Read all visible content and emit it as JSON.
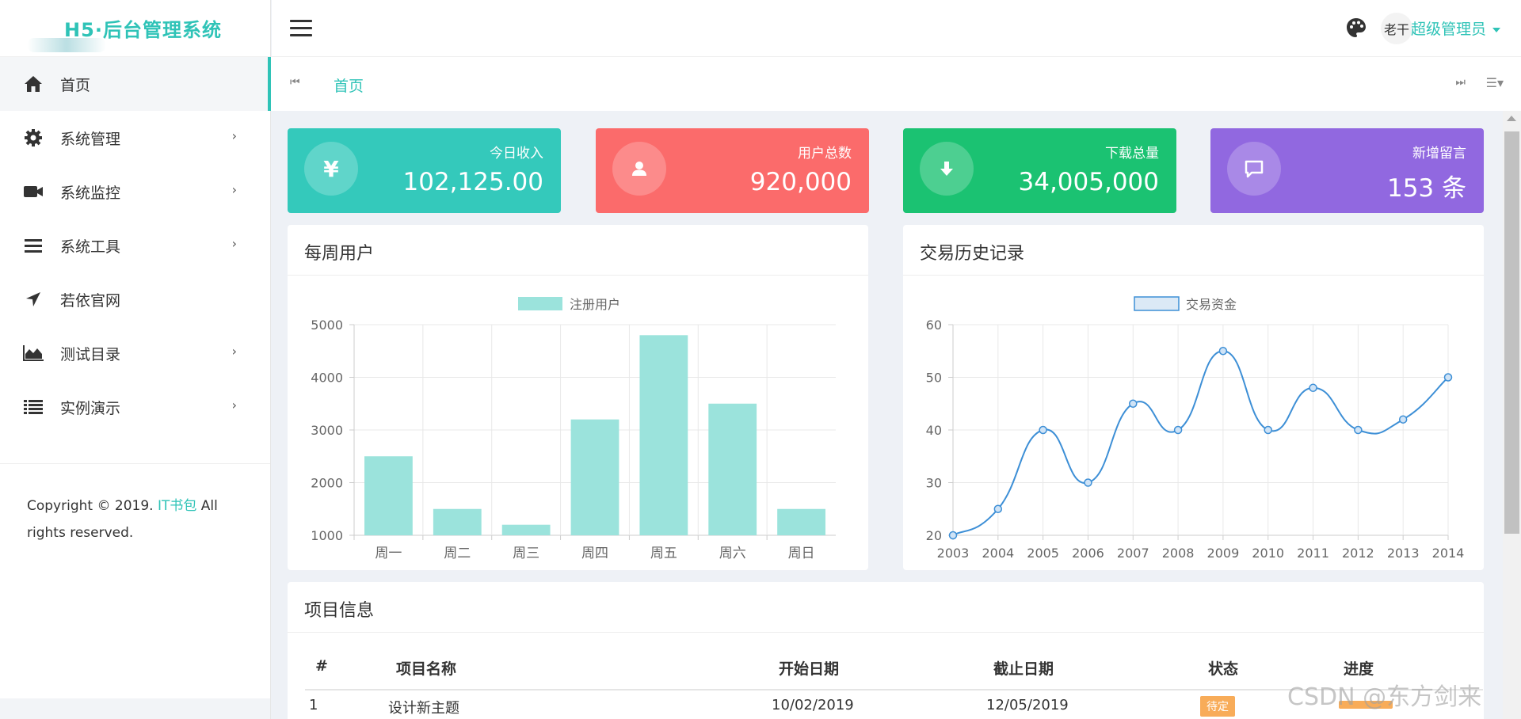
{
  "app": {
    "logo_text": "H5·后台管理系统"
  },
  "colors": {
    "accent": "#2fc3b7",
    "income": "#34c9bb",
    "users": "#fb6b6b",
    "downloads": "#1bc272",
    "messages": "#9168e0"
  },
  "sidebar": {
    "items": [
      {
        "label": "首页",
        "icon": "home-icon"
      },
      {
        "label": "系统管理",
        "icon": "gear-icon"
      },
      {
        "label": "系统监控",
        "icon": "video-camera-icon"
      },
      {
        "label": "系统工具",
        "icon": "bars-icon"
      },
      {
        "label": "若依官网",
        "icon": "location-arrow-icon"
      },
      {
        "label": "测试目录",
        "icon": "area-chart-icon"
      },
      {
        "label": "实例演示",
        "icon": "list-icon"
      }
    ],
    "copyright_pre": "Copyright © 2019. ",
    "copyright_link": "IT书包",
    "copyright_post": " All rights reserved."
  },
  "header": {
    "user_name": "超级管理员",
    "avatar_text": "老干"
  },
  "tabs": {
    "home": "首页"
  },
  "stats": [
    {
      "label": "今日收入",
      "value": "102,125.00",
      "icon_text": "¥"
    },
    {
      "label": "用户总数",
      "value": "920,000"
    },
    {
      "label": "下载总量",
      "value": "34,005,000"
    },
    {
      "label": "新增留言",
      "value": "153 条"
    }
  ],
  "panels": {
    "weekly_title": "每周用户",
    "history_title": "交易历史记录",
    "projects_title": "项目信息"
  },
  "chart_data": [
    {
      "type": "bar",
      "title": "每周用户",
      "categories": [
        "周一",
        "周二",
        "周三",
        "周四",
        "周五",
        "周六",
        "周日"
      ],
      "series": [
        {
          "name": "注册用户",
          "values": [
            2500,
            1500,
            1200,
            3200,
            4800,
            3500,
            1500
          ]
        }
      ],
      "yticks": [
        "1000",
        "2000",
        "3000",
        "4000",
        "5000"
      ],
      "ylim": [
        1000,
        5000
      ],
      "color": "#9be3dc"
    },
    {
      "type": "line",
      "title": "交易历史记录",
      "categories": [
        "2003",
        "2004",
        "2005",
        "2006",
        "2007",
        "2008",
        "2009",
        "2010",
        "2011",
        "2012",
        "2013",
        "2014"
      ],
      "series": [
        {
          "name": "交易资金",
          "values": [
            20,
            25,
            40,
            30,
            45,
            40,
            55,
            40,
            48,
            40,
            42,
            50
          ]
        }
      ],
      "yticks": [
        "20",
        "30",
        "40",
        "50",
        "60"
      ],
      "ylim": [
        20,
        60
      ],
      "color": "#3d8fd6"
    }
  ],
  "table": {
    "headers": [
      "#",
      "项目名称",
      "开始日期",
      "截止日期",
      "状态",
      "进度"
    ],
    "rows": [
      {
        "num": "1",
        "name": "设计新主题",
        "start": "10/02/2019",
        "end": "12/05/2019",
        "status": "待定"
      }
    ]
  },
  "watermark": "CSDN @东方剑来"
}
